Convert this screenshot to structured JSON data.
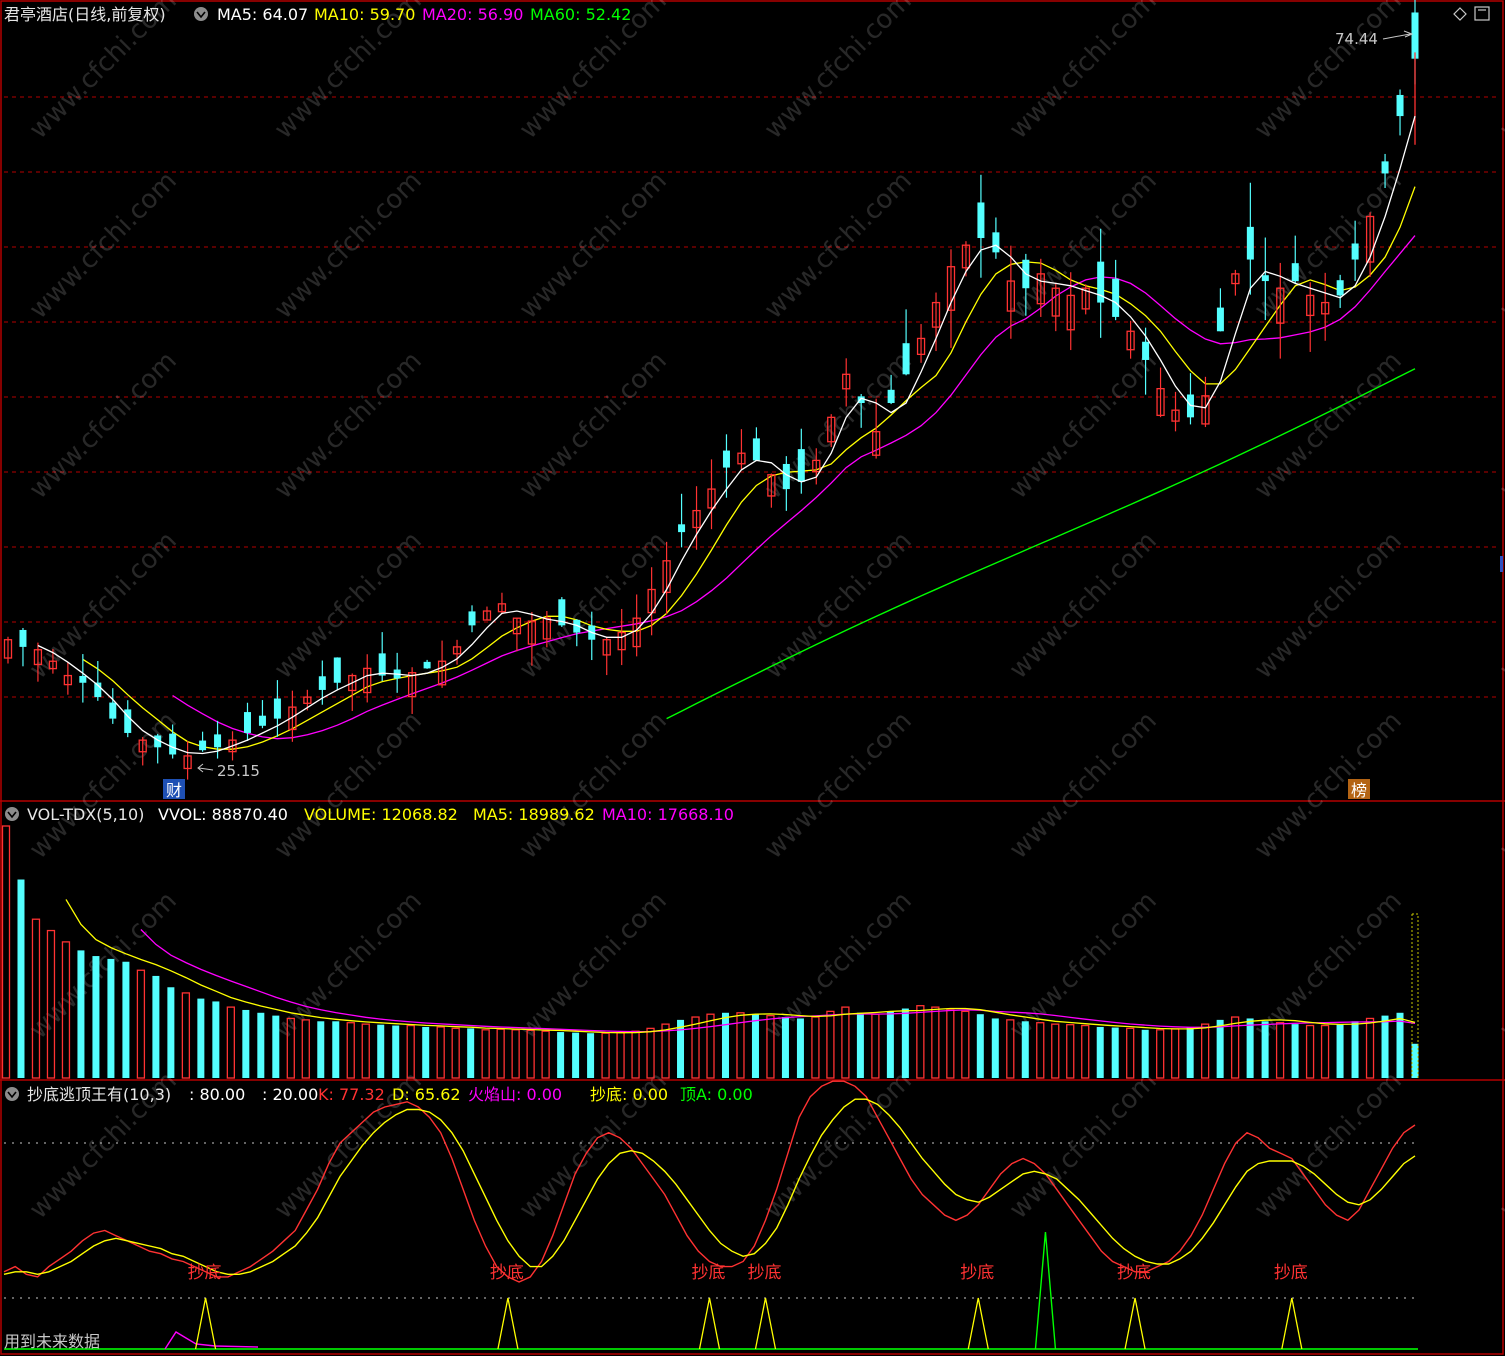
{
  "app": {
    "stock_title": "君亭酒店(日线,前复权)",
    "colors": {
      "bg": "#000000",
      "up": "#ff3232",
      "down": "#54ffff",
      "ma5": "#ffffff",
      "ma10": "#ffff00",
      "ma20": "#ff00ff",
      "ma60": "#00ff00",
      "grid": "#b40000",
      "frame": "#b40000"
    }
  },
  "panel_price": {
    "legend": [
      {
        "label": "MA5: 64.07",
        "color": "#ffffff"
      },
      {
        "label": "MA10: 59.70",
        "color": "#ffff00"
      },
      {
        "label": "MA20: 56.90",
        "color": "#ff00ff"
      },
      {
        "label": "MA60: 52.42",
        "color": "#00ff00"
      }
    ],
    "high_label": "74.44",
    "low_label": "25.15",
    "badge_left": "财",
    "badge_right": "榜"
  },
  "panel_volume": {
    "name": "VOL-TDX(5,10)",
    "legend": [
      {
        "label": "VVOL: 88870.40",
        "color": "#ffffff"
      },
      {
        "label": "VOLUME: 12068.82",
        "color": "#ffff00"
      },
      {
        "label": "MA5: 18989.62",
        "color": "#ffff00"
      },
      {
        "label": "MA10: 17668.10",
        "color": "#ff00ff"
      }
    ]
  },
  "panel_indicator": {
    "name": "抄底逃顶王有(10,3)",
    "legend": [
      {
        "label": ": 80.00",
        "color": "#ffffff"
      },
      {
        "label": ": 20.00",
        "color": "#ffffff"
      },
      {
        "label": "K: 77.32",
        "color": "#ff3232"
      },
      {
        "label": "D: 65.62",
        "color": "#ffff00"
      },
      {
        "label": "火焰山: 0.00",
        "color": "#ff00ff"
      },
      {
        "label": "抄底: 0.00",
        "color": "#ffff00"
      },
      {
        "label": "顶A: 0.00",
        "color": "#00ff00"
      }
    ],
    "signal_label": "抄底",
    "footer_note": "用到未来数据"
  },
  "chart_data": [
    {
      "type": "candlestick",
      "title": "君亭酒店(日线,前复权)",
      "series": [
        {
          "name": "MA5",
          "last": 64.07
        },
        {
          "name": "MA10",
          "last": 59.7
        },
        {
          "name": "MA20",
          "last": 56.9
        },
        {
          "name": "MA60",
          "last": 52.42
        }
      ],
      "annotations": {
        "high": 74.44,
        "low": 25.15
      },
      "ylim": [
        24,
        76
      ],
      "close_path": [
        33.5,
        33.0,
        32.8,
        32.0,
        31.0,
        30.5,
        29.5,
        28.0,
        27.0,
        26.5,
        26.0,
        25.5,
        25.4,
        25.8,
        26.0,
        26.5,
        27.0,
        27.5,
        28.0,
        28.8,
        29.5,
        30.0,
        30.5,
        31.0,
        31.5,
        31.0,
        30.8,
        31.2,
        31.5,
        32.0,
        33.0,
        34.5,
        35.5,
        36.0,
        35.0,
        34.8,
        35.0,
        34.5,
        34.0,
        33.5,
        33.5,
        34.0,
        35.0,
        37.0,
        39.0,
        41.0,
        42.5,
        44.0,
        45.5,
        46.5,
        46.0,
        45.0,
        44.0,
        44.5,
        46.0,
        49.0,
        52.0,
        50.0,
        48.0,
        50.0,
        52.0,
        54.5,
        57.0,
        59.5,
        61.0,
        61.5,
        60.5,
        58.5,
        58.0,
        59.0,
        58.0,
        57.5,
        58.0,
        57.0,
        56.0,
        55.0,
        53.0,
        51.0,
        49.5,
        49.0,
        50.5,
        55.0,
        59.0,
        60.0,
        58.5,
        58.0,
        58.5,
        57.5,
        57.0,
        57.5,
        60.0,
        63.0,
        66.0,
        70.0,
        74.0
      ]
    },
    {
      "type": "bar",
      "title": "VOL-TDX(5,10)",
      "series": [
        {
          "name": "VOLUME",
          "last": 12068.82
        },
        {
          "name": "MA5",
          "last": 18989.62
        },
        {
          "name": "MA10",
          "last": 17668.1
        }
      ],
      "values": [
        88870,
        70000,
        56000,
        52000,
        48000,
        45000,
        43000,
        42000,
        41000,
        38000,
        36000,
        32000,
        30000,
        28000,
        27000,
        25000,
        24000,
        23000,
        22000,
        21000,
        20500,
        20000,
        20000,
        19500,
        19000,
        18800,
        18500,
        18500,
        18000,
        18000,
        17500,
        17500,
        17000,
        17200,
        17000,
        16800,
        16500,
        16200,
        16000,
        15800,
        15800,
        16000,
        16500,
        17500,
        19000,
        20500,
        21500,
        22500,
        23000,
        23000,
        22500,
        22000,
        21500,
        21000,
        21500,
        23500,
        25000,
        23000,
        22500,
        23500,
        24500,
        25500,
        25000,
        24000,
        23500,
        22500,
        21000,
        20500,
        20000,
        19500,
        19000,
        18800,
        18500,
        18000,
        17800,
        17500,
        17000,
        17000,
        17300,
        18000,
        19000,
        20500,
        21500,
        21000,
        20000,
        19500,
        19000,
        18500,
        18500,
        19000,
        20000,
        21000,
        22000,
        23000,
        12068
      ]
    },
    {
      "type": "line",
      "title": "抄底逃顶王有(10,3)",
      "ylim": [
        -10,
        110
      ],
      "series": [
        {
          "name": "K",
          "last": 77.32,
          "values": [
            20,
            22,
            19,
            18,
            22,
            25,
            28,
            32,
            35,
            36,
            34,
            32,
            30,
            28,
            27,
            25,
            24,
            22,
            20,
            18,
            18,
            20,
            22,
            25,
            28,
            32,
            36,
            44,
            52,
            62,
            70,
            74,
            78,
            82,
            84,
            85,
            86,
            84,
            80,
            74,
            64,
            52,
            40,
            30,
            22,
            18,
            16,
            18,
            24,
            34,
            46,
            58,
            66,
            72,
            74,
            72,
            68,
            62,
            56,
            50,
            42,
            34,
            28,
            24,
            22,
            22,
            24,
            30,
            40,
            52,
            66,
            80,
            88,
            92,
            94,
            94,
            92,
            88,
            80,
            72,
            64,
            56,
            50,
            46,
            42,
            40,
            42,
            46,
            52,
            58,
            62,
            64,
            62,
            58,
            52,
            46,
            40,
            34,
            28,
            24,
            22,
            20,
            20,
            22,
            24,
            28,
            34,
            42,
            52,
            62,
            70,
            74,
            72,
            68,
            66,
            64,
            58,
            52,
            46,
            42,
            40,
            44,
            52,
            60,
            68,
            74,
            77
          ]
        },
        {
          "name": "D",
          "last": 65.62,
          "values": [
            19,
            20,
            20,
            19,
            20,
            22,
            24,
            27,
            30,
            32,
            33,
            32,
            31,
            30,
            29,
            27,
            26,
            24,
            22,
            20,
            19,
            19,
            20,
            22,
            24,
            27,
            30,
            35,
            41,
            49,
            57,
            63,
            69,
            74,
            78,
            81,
            83,
            83,
            82,
            79,
            74,
            67,
            58,
            49,
            40,
            32,
            26,
            22,
            22,
            26,
            32,
            40,
            48,
            56,
            62,
            66,
            67,
            66,
            63,
            59,
            54,
            48,
            42,
            36,
            31,
            28,
            26,
            27,
            31,
            37,
            46,
            56,
            65,
            73,
            79,
            84,
            87,
            87,
            85,
            81,
            76,
            70,
            64,
            59,
            54,
            50,
            48,
            47,
            49,
            52,
            55,
            58,
            59,
            58,
            56,
            52,
            48,
            43,
            38,
            33,
            29,
            26,
            24,
            23,
            23,
            25,
            28,
            33,
            39,
            46,
            53,
            59,
            62,
            63,
            63,
            63,
            61,
            58,
            54,
            50,
            47,
            46,
            48,
            52,
            57,
            62,
            65
          ]
        }
      ]
    }
  ]
}
